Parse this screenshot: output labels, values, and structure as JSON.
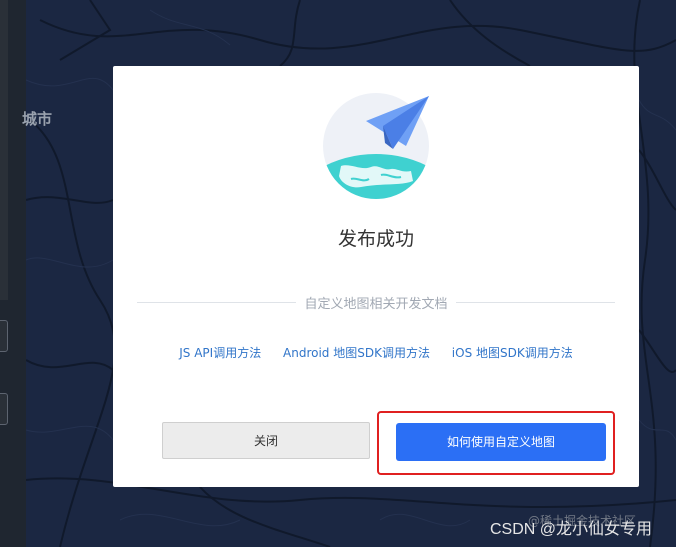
{
  "map": {
    "city_label": "城市"
  },
  "modal": {
    "title": "发布成功",
    "docs_label": "自定义地图相关开发文档",
    "links": [
      {
        "label": "JS API调用方法"
      },
      {
        "label": "Android 地图SDK调用方法"
      },
      {
        "label": "iOS 地图SDK调用方法"
      }
    ],
    "close_label": "关闭",
    "primary_label": "如何使用自定义地图"
  },
  "watermarks": {
    "faint": "@稀土掘金技术社区",
    "main": "CSDN @龙小仙女专用"
  },
  "colors": {
    "map_bg": "#1b2742",
    "primary": "#2b6ff5",
    "link": "#3175c9",
    "highlight": "#e02020"
  }
}
